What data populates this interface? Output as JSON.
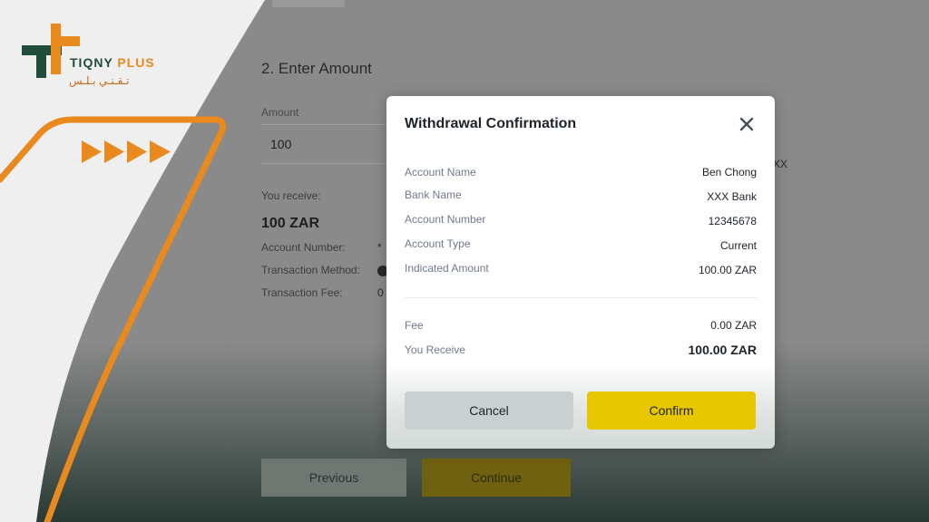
{
  "page": {
    "section_title": "2. Enter Amount",
    "amount_label": "Amount",
    "amount_value": "100",
    "amount_suffix": "XX",
    "receive_label": "You receive:",
    "receive_amount": "100 ZAR",
    "account_number_label": "Account Number:",
    "account_number_value": "*",
    "transaction_method_label": "Transaction Method:",
    "transaction_fee_label": "Transaction Fee:",
    "transaction_fee_value": "0",
    "previous_label": "Previous",
    "continue_label": "Continue"
  },
  "logo": {
    "name_en_main": "TIQNY",
    "name_en_accent": "PLUS",
    "name_ar": "تـقـنـي بـلـس"
  },
  "modal": {
    "title": "Withdrawal Confirmation",
    "rows": [
      {
        "label": "Account Name",
        "value": "Ben Chong"
      },
      {
        "label": "Bank Name",
        "value": "XXX Bank"
      },
      {
        "label": "Account Number",
        "value": "12345678"
      },
      {
        "label": "Account Type",
        "value": "Current"
      },
      {
        "label": "Indicated Amount",
        "value": "100.00 ZAR"
      }
    ],
    "fee": {
      "label": "Fee",
      "value": "0.00 ZAR"
    },
    "receive": {
      "label": "You Receive",
      "value": "100.00 ZAR"
    },
    "cancel_label": "Cancel",
    "confirm_label": "Confirm"
  },
  "colors": {
    "confirm_button": "#e6c700",
    "cancel_button": "#c9d0cf",
    "brand_green": "#1f4d3a",
    "brand_orange": "#e88a1e"
  },
  "icons": {
    "close": "close-icon",
    "logo": "tiqny-plus-logo-icon",
    "arrows": "double-play-arrows-icon"
  }
}
